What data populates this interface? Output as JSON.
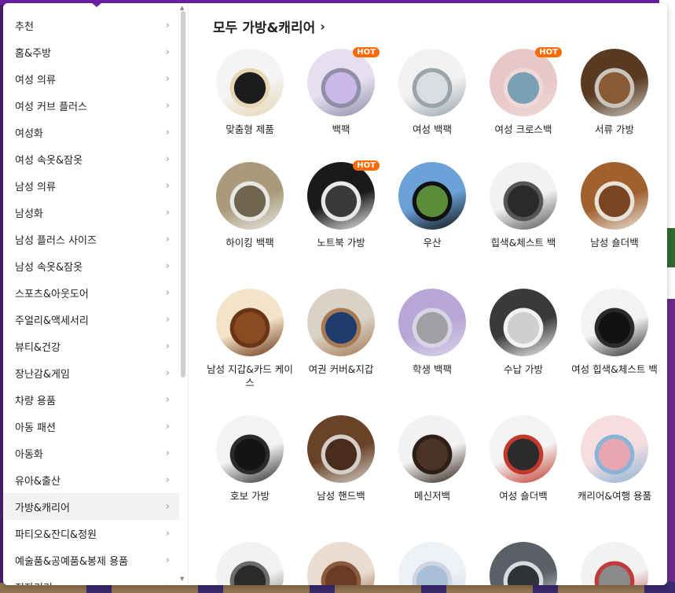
{
  "sidebar": {
    "categories": [
      "추천",
      "홈&주방",
      "여성 의류",
      "여성 커브 플러스",
      "여성화",
      "여성 속옷&잠옷",
      "남성 의류",
      "남성화",
      "남성 플러스 사이즈",
      "남성 속옷&잠옷",
      "스포츠&아웃도어",
      "주얼리&액세서리",
      "뷰티&건강",
      "장난감&게임",
      "차량 용품",
      "아동 패션",
      "아동화",
      "유아&출산",
      "가방&캐리어",
      "파티오&잔디&정원",
      "예술품&공예품&봉제 용품",
      "전자기기"
    ],
    "active_index": 18,
    "chevron": "›"
  },
  "main": {
    "title": "모두 가방&캐리어",
    "title_arrow": "›",
    "hot_label": "HOT",
    "items": [
      {
        "label": "맞춤형 제품",
        "hot": false,
        "icon": "custom-tote-bag-image",
        "colors": [
          "#f4f4f4",
          "#1c1c1c",
          "#e6d6b3"
        ]
      },
      {
        "label": "백팩",
        "hot": true,
        "icon": "lavender-backpack-image",
        "colors": [
          "#e5dff0",
          "#c9b8e8",
          "#8f8fa8"
        ]
      },
      {
        "label": "여성 백팩",
        "hot": false,
        "icon": "white-backpack-image",
        "colors": [
          "#f2f2f2",
          "#d9dde0",
          "#9aa4ab"
        ]
      },
      {
        "label": "여성 크로스백",
        "hot": true,
        "icon": "pink-blue-crossbody-image",
        "colors": [
          "#e8c7c7",
          "#7aa0b5",
          "#f1d8d8"
        ]
      },
      {
        "label": "서류 가방",
        "hot": false,
        "icon": "leather-briefcase-image",
        "colors": [
          "#5a3b22",
          "#8a5a34",
          "#c9c4bc"
        ]
      },
      {
        "label": "하이킹 백팩",
        "hot": false,
        "icon": "camo-hiking-backpack-image",
        "colors": [
          "#a89a7a",
          "#6f654c",
          "#e8e6e2"
        ]
      },
      {
        "label": "노트북 가방",
        "hot": true,
        "icon": "laptop-bag-image",
        "colors": [
          "#1a1a1a",
          "#3a3a3a",
          "#e9e9e9"
        ]
      },
      {
        "label": "우산",
        "hot": false,
        "icon": "black-umbrella-image",
        "colors": [
          "#6aa2d8",
          "#5b8c3a",
          "#111111"
        ]
      },
      {
        "label": "힙색&체스트 백",
        "hot": false,
        "icon": "sling-chest-bag-image",
        "colors": [
          "#f2f2f2",
          "#2a2a2a",
          "#555555"
        ]
      },
      {
        "label": "남성 숄더백",
        "hot": false,
        "icon": "brown-shoulder-bag-image",
        "colors": [
          "#a0612f",
          "#7a4522",
          "#e9e2d9"
        ]
      },
      {
        "label": "남성 지갑&카드 케이스",
        "hot": false,
        "icon": "brown-wallets-image",
        "colors": [
          "#f3e4c9",
          "#8a4a22",
          "#6a3416"
        ]
      },
      {
        "label": "여권 커버&지갑",
        "hot": false,
        "icon": "passport-cover-image",
        "colors": [
          "#d9d2c5",
          "#1f3c6e",
          "#a67a55"
        ]
      },
      {
        "label": "학생 백팩",
        "hot": false,
        "icon": "student-backpack-image",
        "colors": [
          "#b7a6d6",
          "#9ea0a4",
          "#d8d4e6"
        ]
      },
      {
        "label": "수납 가방",
        "hot": false,
        "icon": "storage-bags-image",
        "colors": [
          "#3a3a3a",
          "#cfcfcf",
          "#f2f2f2"
        ]
      },
      {
        "label": "여성 힙색&체스트 백",
        "hot": false,
        "icon": "smiley-sling-bag-image",
        "colors": [
          "#f3f3f3",
          "#111111",
          "#2a2a2a"
        ]
      },
      {
        "label": "호보 가방",
        "hot": false,
        "icon": "black-hobo-bag-image",
        "colors": [
          "#f3f3f3",
          "#141414",
          "#2b2b2b"
        ]
      },
      {
        "label": "남성 핸드백",
        "hot": false,
        "icon": "leather-messenger-image",
        "colors": [
          "#6a4228",
          "#4a2c1a",
          "#d4cfc8"
        ]
      },
      {
        "label": "메신저백",
        "hot": false,
        "icon": "brown-messenger-image",
        "colors": [
          "#f2f2f2",
          "#4a3326",
          "#2e1f16"
        ]
      },
      {
        "label": "여성 숄더백",
        "hot": false,
        "icon": "patchwork-shoulder-bag-image",
        "colors": [
          "#f3f3f3",
          "#2b2b2b",
          "#c0392b"
        ]
      },
      {
        "label": "캐리어&여행 용품",
        "hot": false,
        "icon": "pink-travel-bags-image",
        "colors": [
          "#f6dde0",
          "#e7a6b2",
          "#8ab4d6"
        ]
      },
      {
        "label": "",
        "hot": false,
        "icon": "black-tote-image",
        "colors": [
          "#f2f2f2",
          "#2a2a2a",
          "#6b6b6b"
        ]
      },
      {
        "label": "",
        "hot": false,
        "icon": "brown-tote-image",
        "colors": [
          "#e9ddd0",
          "#6a3a24",
          "#8a5a3c"
        ]
      },
      {
        "label": "",
        "hot": false,
        "icon": "blue-pouch-image",
        "colors": [
          "#eef1f5",
          "#a9bfd8",
          "#cdd6e2"
        ]
      },
      {
        "label": "",
        "hot": false,
        "icon": "grey-organizer-image",
        "colors": [
          "#5b6068",
          "#2f3338",
          "#d9dbde"
        ]
      },
      {
        "label": "",
        "hot": false,
        "icon": "cable-organizer-image",
        "colors": [
          "#f2f2f2",
          "#8a8a8a",
          "#c23b3b"
        ]
      }
    ]
  }
}
